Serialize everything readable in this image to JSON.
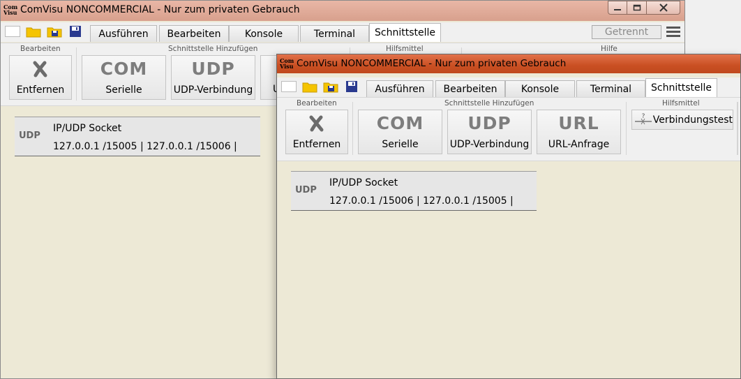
{
  "windows": [
    {
      "app_icon": "Com Visu",
      "title": "ComVisu NONCOMMERCIAL - Nur zum privaten Gebrauch",
      "caption_buttons": {
        "minimize": "minimize-icon",
        "maximize": "maximize-icon",
        "close": "close-icon"
      },
      "quick_icons": [
        "blank-page-icon",
        "folder-icon",
        "folder-save-icon",
        "floppy-save-icon"
      ],
      "tabs": [
        "Ausführen",
        "Bearbeiten",
        "Konsole",
        "Terminal",
        "Schnittstelle"
      ],
      "active_tab": "Schnittstelle",
      "status_button": "Getrennt",
      "menu_icon": "hamburger-menu-icon",
      "ribbon": {
        "groups": [
          "Bearbeiten",
          "Schnittstelle Hinzufügen",
          "Hilfsmittel",
          "Hilfe"
        ],
        "buttons": [
          {
            "big": "",
            "icon": "remove-x-icon",
            "label": "Entfernen"
          },
          {
            "big": "COM",
            "label": "Serielle"
          },
          {
            "big": "UDP",
            "label": "UDP-Verbindung"
          },
          {
            "big": "",
            "label": "U"
          }
        ]
      },
      "socket": {
        "badge": "UDP",
        "name": "IP/UDP Socket",
        "address": "127.0.0.1 /15005 | 127.0.0.1 /15006 |"
      }
    },
    {
      "app_icon": "Com Visu",
      "title": "ComVisu NONCOMMERCIAL - Nur zum privaten Gebrauch",
      "quick_icons": [
        "blank-page-icon",
        "folder-icon",
        "folder-save-icon",
        "floppy-save-icon"
      ],
      "tabs": [
        "Ausführen",
        "Bearbeiten",
        "Konsole",
        "Terminal",
        "Schnittstelle"
      ],
      "active_tab": "Schnittstelle",
      "ribbon": {
        "groups": [
          "Bearbeiten",
          "Schnittstelle Hinzufügen",
          "Hilfsmittel"
        ],
        "buttons": [
          {
            "big": "",
            "icon": "remove-x-icon",
            "label": "Entfernen"
          },
          {
            "big": "COM",
            "label": "Serielle"
          },
          {
            "big": "UDP",
            "label": "UDP-Verbindung"
          },
          {
            "big": "URL",
            "label": "URL-Anfrage"
          }
        ],
        "tool_button": {
          "icon": "connection-test-icon",
          "label": "Verbindungstest"
        }
      },
      "socket": {
        "badge": "UDP",
        "name": "IP/UDP Socket",
        "address": "127.0.0.1 /15006 | 127.0.0.1 /15005 |"
      }
    }
  ],
  "colors": {
    "content_bg": "#ede9d6",
    "active_title": "#c94f22",
    "inactive_title": "#d8a08d",
    "ribbon_bg": "#f0f0f0"
  }
}
